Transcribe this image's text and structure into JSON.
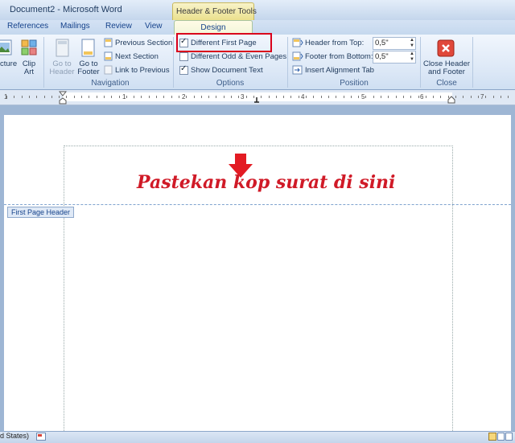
{
  "window": {
    "title": "Document2 - Microsoft Word",
    "context_group": "Header & Footer Tools"
  },
  "tabs": [
    "References",
    "Mailings",
    "Review",
    "View"
  ],
  "active_tab": "Design",
  "insert_group": {
    "picture": "cture",
    "clip_art_line1": "Clip",
    "clip_art_line2": "Art"
  },
  "navigation": {
    "label": "Navigation",
    "go_to_header": [
      "Go to",
      "Header"
    ],
    "go_to_footer": [
      "Go to",
      "Footer"
    ],
    "previous_section": "Previous Section",
    "next_section": "Next Section",
    "link_to_previous": "Link to Previous"
  },
  "options": {
    "label": "Options",
    "different_first_page": {
      "label": "Different First Page",
      "checked": true
    },
    "different_odd_even": {
      "label": "Different Odd & Even Pages",
      "checked": false
    },
    "show_document_text": {
      "label": "Show Document Text",
      "checked": true
    }
  },
  "position": {
    "label": "Position",
    "header_from_top": {
      "label": "Header from Top:",
      "value": "0,5\""
    },
    "footer_from_bottom": {
      "label": "Footer from Bottom:",
      "value": "0,5\""
    },
    "insert_alignment_tab": "Insert Alignment Tab"
  },
  "close": {
    "label": "Close",
    "button_line1": "Close Header",
    "button_line2": "and Footer"
  },
  "ruler": {
    "numbers": [
      "1",
      "2",
      "3",
      "4",
      "5",
      "6",
      "7"
    ]
  },
  "document": {
    "header_tag": "First Page Header",
    "overlay_text": "Pastekan kop surat di sini"
  },
  "status": {
    "language": "d States)"
  },
  "colors": {
    "highlight": "#d9001b",
    "overlay_text": "#d01a27",
    "ribbon": "#dbe7f6"
  }
}
